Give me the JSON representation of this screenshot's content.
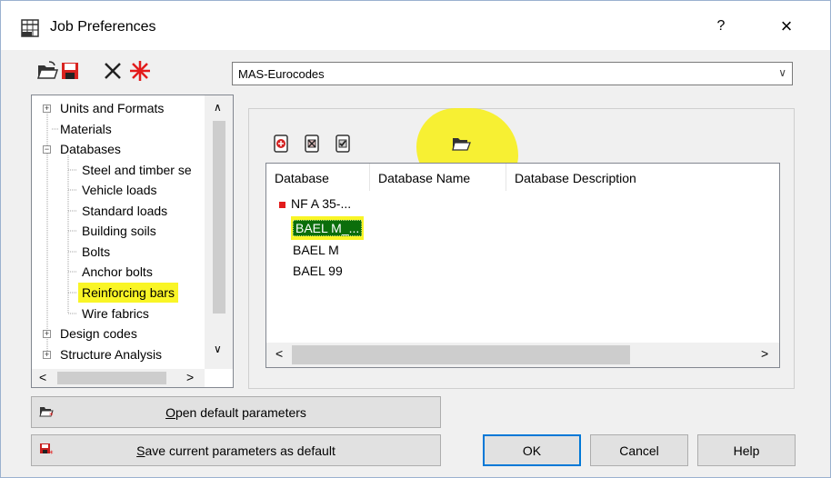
{
  "window": {
    "title": "Job Preferences",
    "help_label": "?",
    "close_label": "×"
  },
  "toolbar": {
    "icons": [
      "open-folder-icon",
      "save-disk-icon",
      "delete-x-icon",
      "new-star-icon"
    ]
  },
  "preferences_combo": {
    "value": "MAS-Eurocodes",
    "arrow": "∨"
  },
  "tree": {
    "items": [
      {
        "label": "Units and Formats",
        "expander": "+"
      },
      {
        "label": "Materials"
      },
      {
        "label": "Databases",
        "expander": "−"
      },
      {
        "label": "Steel and timber se"
      },
      {
        "label": "Vehicle loads"
      },
      {
        "label": "Standard loads"
      },
      {
        "label": "Building soils"
      },
      {
        "label": "Bolts"
      },
      {
        "label": "Anchor bolts"
      },
      {
        "label": "Reinforcing bars"
      },
      {
        "label": "Wire fabrics"
      },
      {
        "label": "Design codes",
        "expander": "+"
      },
      {
        "label": "Structure Analysis",
        "expander": "+"
      }
    ],
    "scroll_up": "∧",
    "scroll_down": "∨",
    "scroll_left": "<",
    "scroll_right": ">"
  },
  "database_panel": {
    "buttons": [
      "add-database-icon",
      "remove-database-icon",
      "check-database-icon",
      "open-folder-icon"
    ],
    "columns": [
      "Database",
      "Database Name",
      "Database Description"
    ],
    "rows": [
      {
        "database": "NF A 35-...",
        "marker": true
      },
      {
        "database": "BAEL M_...",
        "selected": true
      },
      {
        "database": "BAEL M"
      },
      {
        "database": "BAEL 99"
      }
    ],
    "scroll_left": "<",
    "scroll_right": ">"
  },
  "buttons": {
    "open_default_prefix": "O",
    "open_default_rest": "pen default parameters",
    "save_default_prefix": "S",
    "save_default_rest": "ave current parameters as default",
    "ok": "OK",
    "cancel": "Cancel",
    "help": "Help"
  },
  "colors": {
    "selection": "#0b6e0b",
    "highlight": "#f9f526",
    "accent": "#0078d7"
  }
}
